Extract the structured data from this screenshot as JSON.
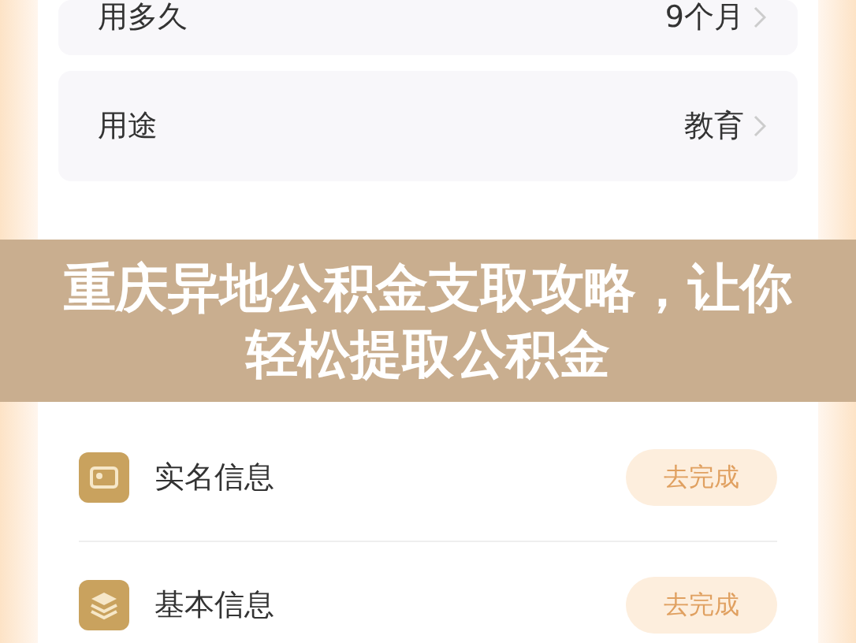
{
  "rows": [
    {
      "label": "用多久",
      "value": "9个月"
    },
    {
      "label": "用途",
      "value": "教育"
    }
  ],
  "banner": {
    "title": "重庆异地公积金支取攻略，让你轻松提取公积金"
  },
  "tasks": [
    {
      "kind": "id-card",
      "label": "实名信息",
      "action": "去完成"
    },
    {
      "kind": "layers",
      "label": "基本信息",
      "action": "去完成"
    }
  ]
}
